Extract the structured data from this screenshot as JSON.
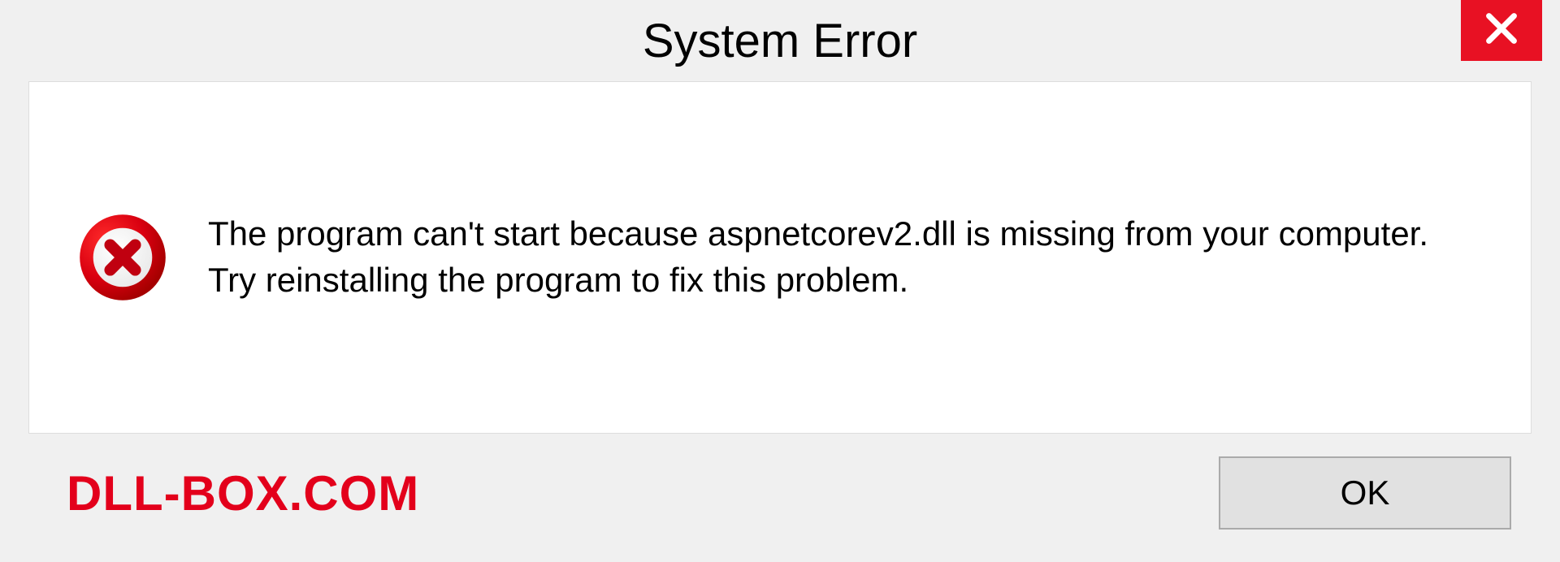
{
  "dialog": {
    "title": "System Error",
    "message": "The program can't start because aspnetcorev2.dll is missing from your computer. Try reinstalling the program to fix this problem.",
    "ok_label": "OK"
  },
  "watermark": "DLL-BOX.COM",
  "colors": {
    "close_bg": "#e81123",
    "error_icon": "#d90010",
    "watermark": "#e3001b"
  }
}
